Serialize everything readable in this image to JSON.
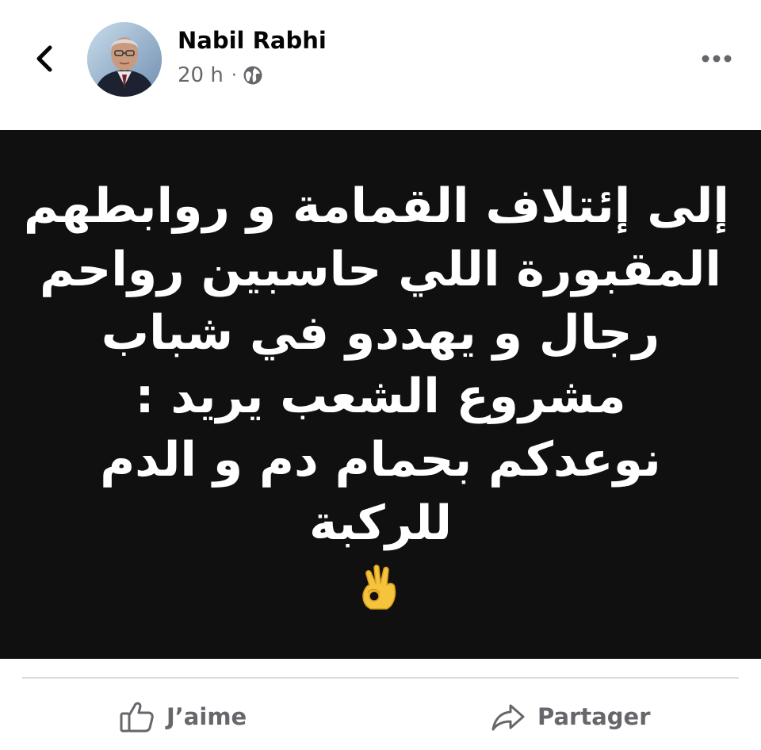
{
  "nav": {
    "back_icon": "chevron-left-icon",
    "more_icon": "more-horizontal-icon"
  },
  "post": {
    "author": "Nabil Rabhi",
    "time": "20 h",
    "separator": "·",
    "audience_icon": "globe-icon",
    "image_text_lines": [
      "إلى إئتلاف القمامة و روابطهم",
      "المقبورة اللي حاسبين رواحم",
      "رجال و يهددو في شباب",
      "مشروع الشعب يريد :",
      "نوعدكم بحمام دم و الدم",
      "للركبة"
    ],
    "image_emoji": "ok-hand-emoji"
  },
  "actions": {
    "like_label": "J’aime",
    "like_icon": "thumbs-up-icon",
    "share_label": "Partager",
    "share_icon": "share-arrow-icon"
  },
  "colors": {
    "image_background": "#101010",
    "secondary_text": "#65676b",
    "divider": "#dadde1"
  }
}
